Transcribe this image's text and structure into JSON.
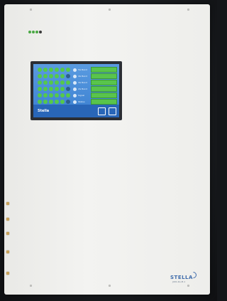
{
  "product": {
    "brand_name": "STELLA",
    "model_line": "JUDI-4G-M-1"
  },
  "status_leds": [
    {
      "color": "#4aa844"
    },
    {
      "color": "#4aa844"
    },
    {
      "color": "#4aa844"
    },
    {
      "color": "#3a3a3a"
    }
  ],
  "display": {
    "brand_label": "Stella",
    "status_rows": [
      {
        "label": "5G Band",
        "status": "OK"
      },
      {
        "label": "4G Band",
        "status": "OK"
      },
      {
        "label": "3G Band",
        "status": "OK"
      },
      {
        "label": "2G Band",
        "status": "OK"
      },
      {
        "label": "Signal",
        "status": "OK"
      },
      {
        "label": "Status",
        "status": "OK"
      }
    ],
    "accent_colors": {
      "ok": "#56c94a",
      "screen_blue": "#3a7fd0"
    }
  }
}
